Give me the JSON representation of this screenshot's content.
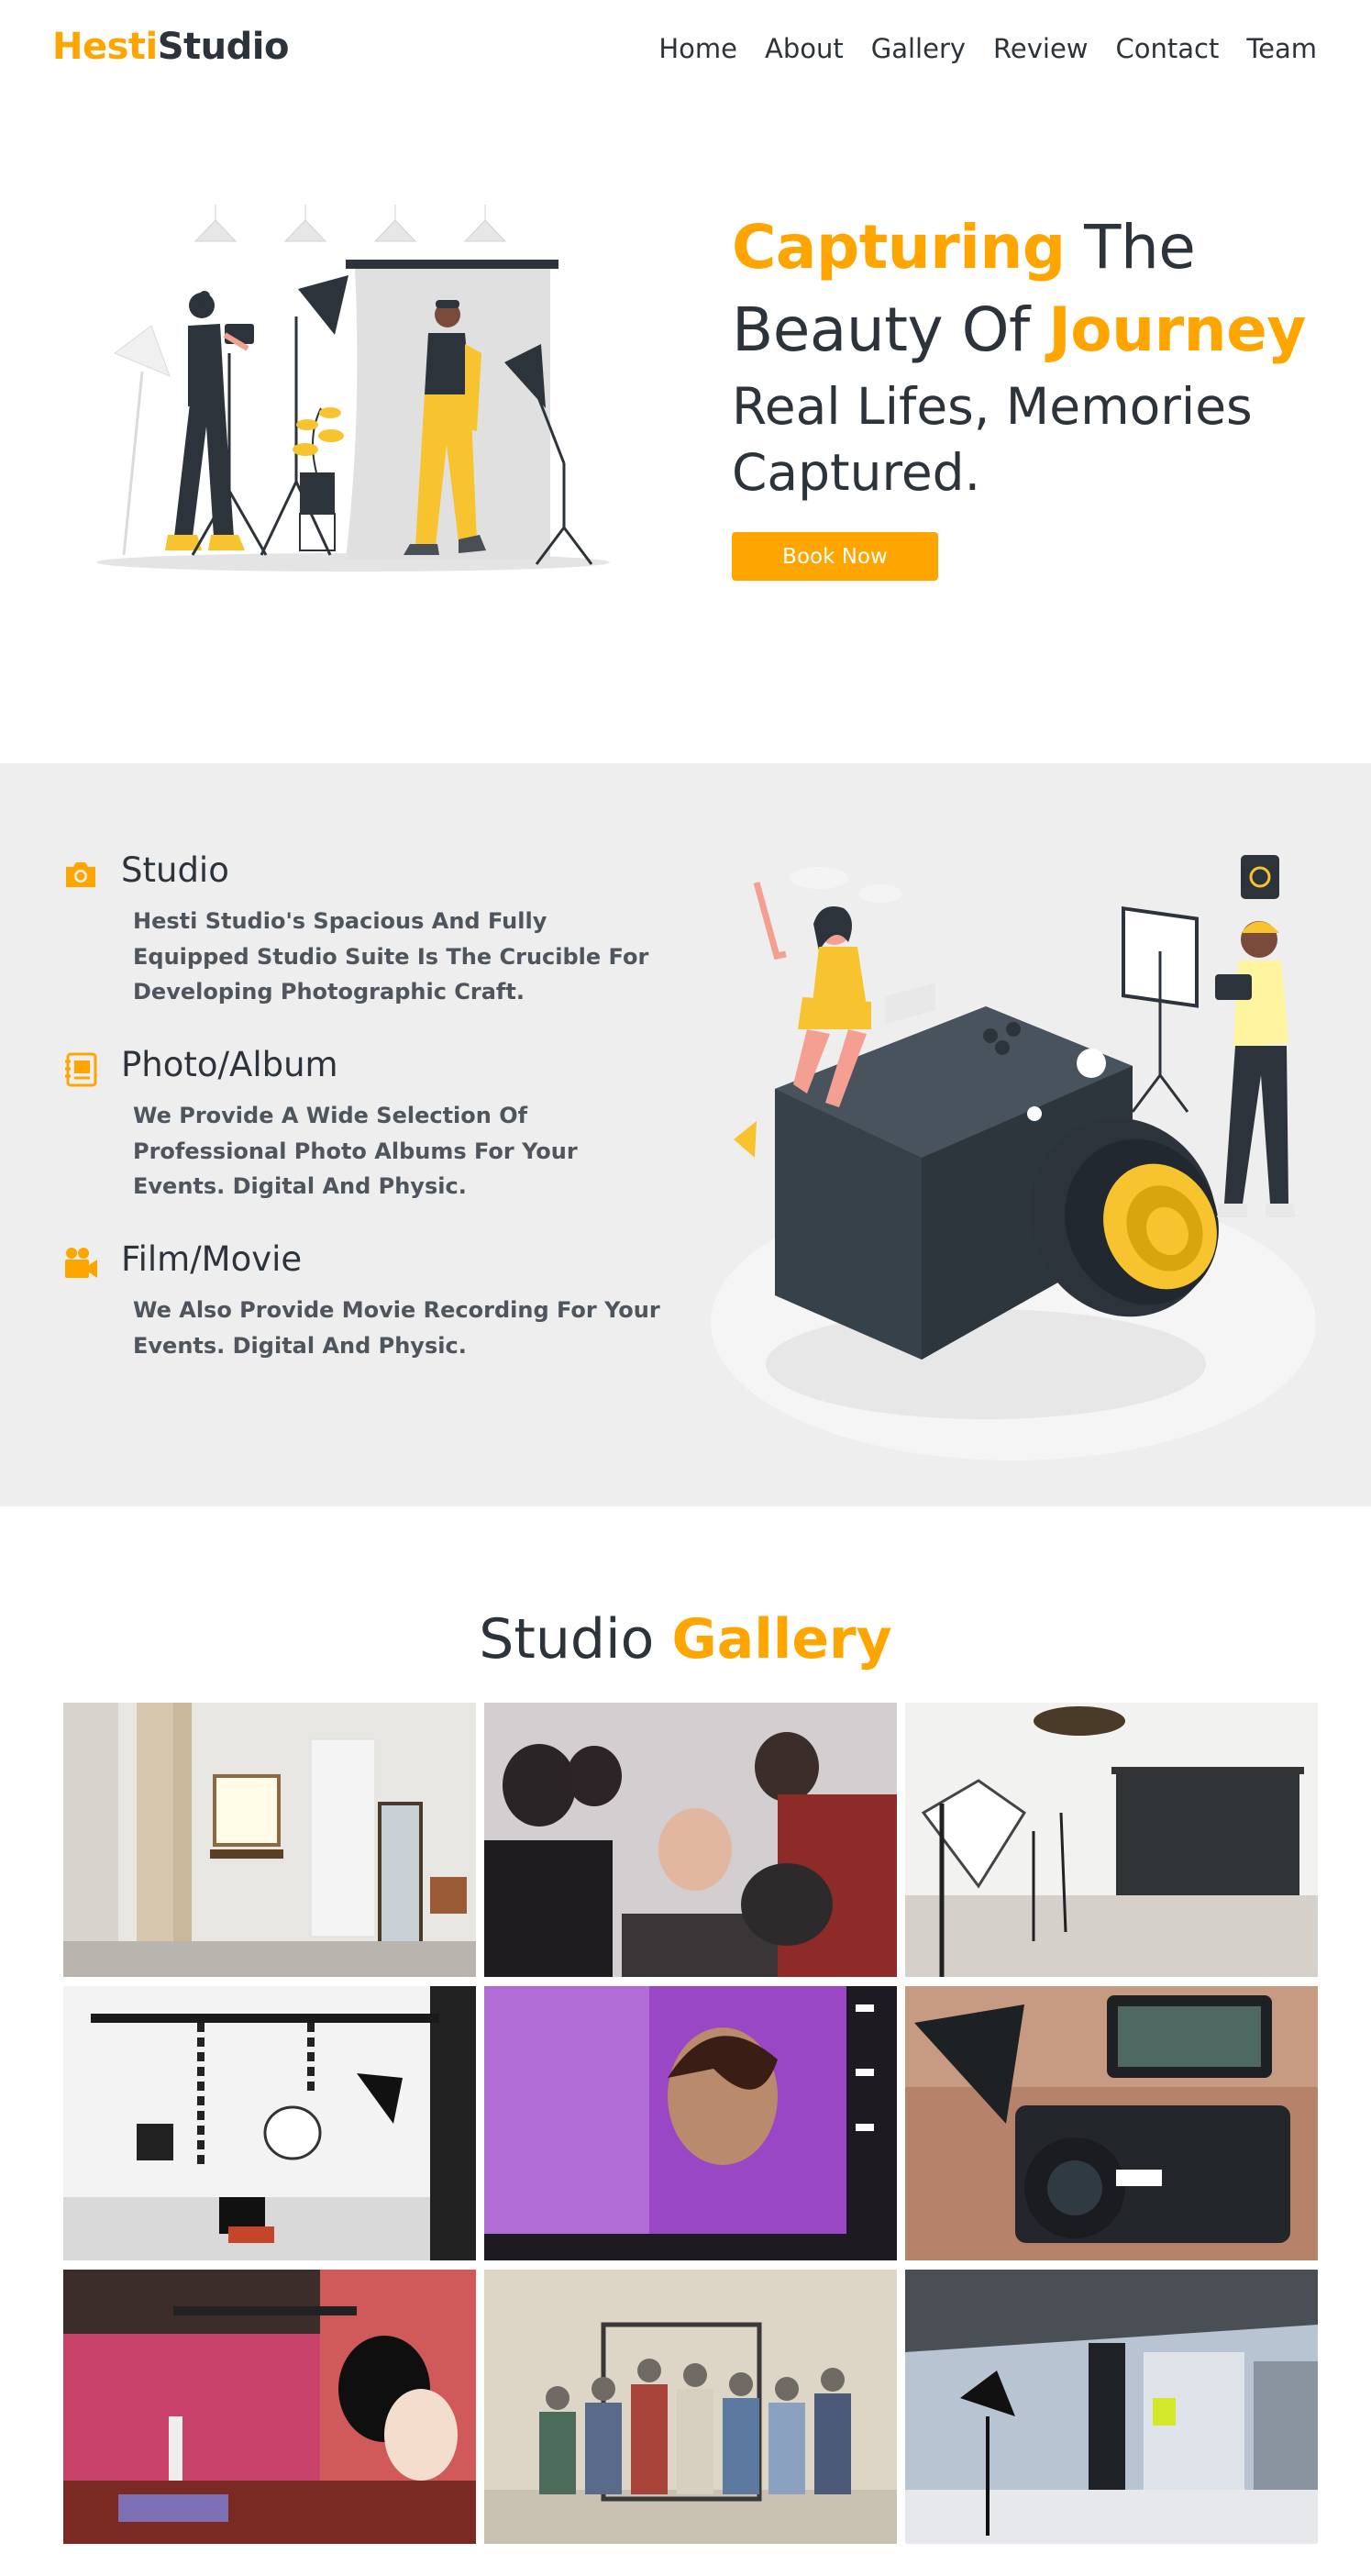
{
  "brand": {
    "part1": "Hesti",
    "part2": "Studio"
  },
  "nav": [
    "Home",
    "About",
    "Gallery",
    "Review",
    "Contact",
    "Team"
  ],
  "hero": {
    "line1_highlight": "Capturing",
    "line1_rest": " The",
    "line2_plain": "Beauty Of ",
    "line2_highlight": "Journey",
    "subtitle_1": "Real Lifes, Memories",
    "subtitle_2": "Captured.",
    "button": "Book Now"
  },
  "services": [
    {
      "icon": "camera-icon",
      "title": "Studio",
      "desc": "Hesti Studio's Spacious And Fully Equipped Studio Suite Is The Crucible For Developing Photographic Craft."
    },
    {
      "icon": "album-icon",
      "title": "Photo/Album",
      "desc": "We Provide A Wide Selection Of Professional Photo Albums For Your Events. Digital And Physic."
    },
    {
      "icon": "video-camera-icon",
      "title": "Film/Movie",
      "desc": "We Also Provide Movie Recording For Your Events. Digital And Physic."
    }
  ],
  "gallery": {
    "title_plain": "Studio ",
    "title_highlight": "Gallery",
    "photos": [
      "studio-vanity-room",
      "group-photo-shoot",
      "studio-backdrop",
      "lighting-rig",
      "portrait-on-monitor",
      "cinema-camera",
      "red-light-stage",
      "group-portrait-backdrop",
      "industrial-studio"
    ]
  },
  "colors": {
    "accent": "#ffa500",
    "text": "#2d333a",
    "section_bg": "#eeeeee"
  }
}
